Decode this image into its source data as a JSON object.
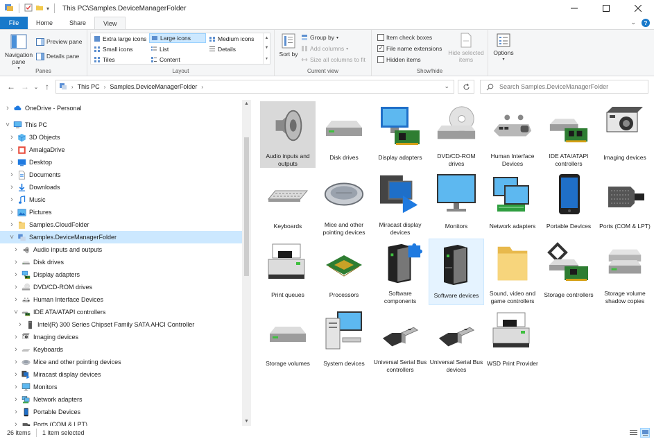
{
  "window": {
    "title": "This PC\\Samples.DeviceManagerFolder",
    "controls": [
      "minimize",
      "maximize",
      "close"
    ]
  },
  "ribbon_tabs": [
    {
      "label": "File",
      "active": false
    },
    {
      "label": "Home",
      "active": false
    },
    {
      "label": "Share",
      "active": false
    },
    {
      "label": "View",
      "active": true
    }
  ],
  "ribbon": {
    "panes": {
      "label": "Panes",
      "navigation_pane": "Navigation pane",
      "preview_pane": "Preview pane",
      "details_pane": "Details pane"
    },
    "layout": {
      "label": "Layout",
      "items": [
        {
          "label": "Extra large icons",
          "selected": false
        },
        {
          "label": "Large icons",
          "selected": true
        },
        {
          "label": "Medium icons",
          "selected": false
        },
        {
          "label": "Small icons",
          "selected": false
        },
        {
          "label": "List",
          "selected": false
        },
        {
          "label": "Details",
          "selected": false
        },
        {
          "label": "Tiles",
          "selected": false
        },
        {
          "label": "Content",
          "selected": false
        }
      ]
    },
    "current_view": {
      "label": "Current view",
      "sort_by": "Sort by",
      "group_by": "Group by",
      "add_columns": "Add columns",
      "size_all_columns": "Size all columns to fit"
    },
    "show_hide": {
      "label": "Show/hide",
      "item_check_boxes": {
        "label": "Item check boxes",
        "checked": false
      },
      "file_name_extensions": {
        "label": "File name extensions",
        "checked": true
      },
      "hidden_items": {
        "label": "Hidden items",
        "checked": false
      },
      "hide_selected_items": "Hide selected items"
    },
    "options": "Options"
  },
  "address": {
    "crumbs": [
      "This PC",
      "Samples.DeviceManagerFolder"
    ],
    "search_placeholder": "Search Samples.DeviceManagerFolder"
  },
  "nav_tree": [
    {
      "label": "OneDrive - Personal",
      "level": 0,
      "chevron": "right",
      "icon": "cloud-icon"
    },
    {
      "label": "This PC",
      "level": 0,
      "chevron": "down",
      "icon": "computer-icon"
    },
    {
      "label": "3D Objects",
      "level": 1,
      "chevron": "right",
      "icon": "cube-icon"
    },
    {
      "label": "AmalgaDrive",
      "level": 1,
      "chevron": "right",
      "icon": "amalga-icon"
    },
    {
      "label": "Desktop",
      "level": 1,
      "chevron": "right",
      "icon": "desktop-icon"
    },
    {
      "label": "Documents",
      "level": 1,
      "chevron": "right",
      "icon": "documents-icon"
    },
    {
      "label": "Downloads",
      "level": 1,
      "chevron": "right",
      "icon": "download-icon"
    },
    {
      "label": "Music",
      "level": 1,
      "chevron": "right",
      "icon": "music-icon"
    },
    {
      "label": "Pictures",
      "level": 1,
      "chevron": "right",
      "icon": "pictures-icon"
    },
    {
      "label": "Samples.CloudFolder",
      "level": 1,
      "chevron": "right",
      "icon": "folder-icon"
    },
    {
      "label": "Samples.DeviceManagerFolder",
      "level": 1,
      "chevron": "down",
      "icon": "device-folder-icon",
      "selected": true
    },
    {
      "label": "Audio inputs and outputs",
      "level": 2,
      "chevron": "right",
      "icon": "speaker-icon"
    },
    {
      "label": "Disk drives",
      "level": 2,
      "chevron": "right",
      "icon": "disk-icon"
    },
    {
      "label": "Display adapters",
      "level": 2,
      "chevron": "right",
      "icon": "display-adapter-icon"
    },
    {
      "label": "DVD/CD-ROM drives",
      "level": 2,
      "chevron": "right",
      "icon": "dvd-icon"
    },
    {
      "label": "Human Interface Devices",
      "level": 2,
      "chevron": "right",
      "icon": "hid-icon"
    },
    {
      "label": "IDE ATA/ATAPI controllers",
      "level": 2,
      "chevron": "down",
      "icon": "ide-icon"
    },
    {
      "label": "Intel(R) 300 Series Chipset Family SATA AHCI Controller",
      "level": 3,
      "chevron": "right",
      "icon": "chip-icon"
    },
    {
      "label": "Imaging devices",
      "level": 2,
      "chevron": "right",
      "icon": "camera-icon"
    },
    {
      "label": "Keyboards",
      "level": 2,
      "chevron": "right",
      "icon": "keyboard-icon"
    },
    {
      "label": "Mice and other pointing devices",
      "level": 2,
      "chevron": "right",
      "icon": "mouse-icon"
    },
    {
      "label": "Miracast display devices",
      "level": 2,
      "chevron": "right",
      "icon": "miracast-icon"
    },
    {
      "label": "Monitors",
      "level": 2,
      "chevron": "right",
      "icon": "monitor-icon"
    },
    {
      "label": "Network adapters",
      "level": 2,
      "chevron": "right",
      "icon": "network-icon"
    },
    {
      "label": "Portable Devices",
      "level": 2,
      "chevron": "right",
      "icon": "portable-icon"
    },
    {
      "label": "Ports (COM & LPT)",
      "level": 2,
      "chevron": "right",
      "icon": "port-icon"
    }
  ],
  "items": [
    {
      "label": "Audio inputs and outputs",
      "icon": "speaker-icon",
      "state": "selected-grey"
    },
    {
      "label": "Disk drives",
      "icon": "disk-icon"
    },
    {
      "label": "Display adapters",
      "icon": "display-adapter-icon"
    },
    {
      "label": "DVD/CD-ROM drives",
      "icon": "dvd-icon"
    },
    {
      "label": "Human Interface Devices",
      "icon": "hid-icon"
    },
    {
      "label": "IDE ATA/ATAPI controllers",
      "icon": "ide-icon"
    },
    {
      "label": "Imaging devices",
      "icon": "camera-icon"
    },
    {
      "label": "Keyboards",
      "icon": "keyboard-icon"
    },
    {
      "label": "Mice and other pointing devices",
      "icon": "mouse-icon"
    },
    {
      "label": "Miracast display devices",
      "icon": "miracast-icon"
    },
    {
      "label": "Monitors",
      "icon": "monitor-icon"
    },
    {
      "label": "Network adapters",
      "icon": "network-icon"
    },
    {
      "label": "Portable Devices",
      "icon": "portable-icon"
    },
    {
      "label": "Ports (COM & LPT)",
      "icon": "port-icon"
    },
    {
      "label": "Print queues",
      "icon": "printer-icon"
    },
    {
      "label": "Processors",
      "icon": "processor-icon"
    },
    {
      "label": "Software components",
      "icon": "software-component-icon"
    },
    {
      "label": "Software devices",
      "icon": "software-device-icon",
      "state": "hover-blue"
    },
    {
      "label": "Sound, video and game controllers",
      "icon": "folder-icon"
    },
    {
      "label": "Storage controllers",
      "icon": "storage-controller-icon"
    },
    {
      "label": "Storage volume shadow copies",
      "icon": "shadow-copy-icon"
    },
    {
      "label": "Storage volumes",
      "icon": "storage-volume-icon"
    },
    {
      "label": "System devices",
      "icon": "system-icon"
    },
    {
      "label": "Universal Serial Bus controllers",
      "icon": "usb-icon"
    },
    {
      "label": "Universal Serial Bus devices",
      "icon": "usb-icon"
    },
    {
      "label": "WSD Print Provider",
      "icon": "printer-icon"
    }
  ],
  "status": {
    "count": "26 items",
    "selection": "1 item selected"
  },
  "colors": {
    "accent": "#1979ca",
    "selection": "#cce8ff",
    "selection_border": "#99d1ff",
    "ribbon_bg": "#f5f6f7"
  }
}
